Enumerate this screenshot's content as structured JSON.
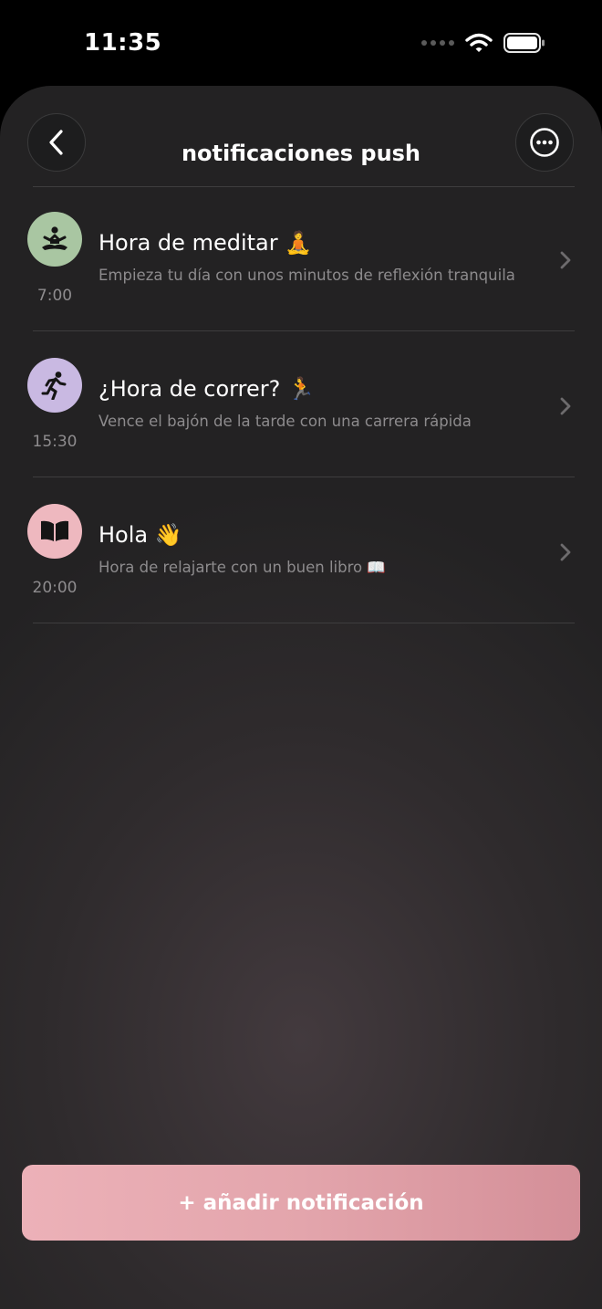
{
  "status_bar": {
    "time": "11:35"
  },
  "header": {
    "title": "notificaciones push",
    "back_icon": "chevron-left-icon",
    "more_icon": "more-horizontal-icon"
  },
  "notifications": [
    {
      "title": "Hora de meditar 🧘",
      "subtitle": "Empieza tu día con unos minutos de reflexión tranquila",
      "time": "7:00",
      "icon": "meditation-icon",
      "color": "#a9c6a2"
    },
    {
      "title": "¿Hora de correr? 🏃",
      "subtitle": "Vence el bajón de la tarde con una carrera rápida",
      "time": "15:30",
      "icon": "running-icon",
      "color": "#c9b9e2"
    },
    {
      "title": "Hola 👋",
      "subtitle": "Hora de relajarte con un buen libro 📖",
      "time": "20:00",
      "icon": "book-icon",
      "color": "#eeb8bf"
    }
  ],
  "footer": {
    "add_label": "+ añadir notificación"
  }
}
